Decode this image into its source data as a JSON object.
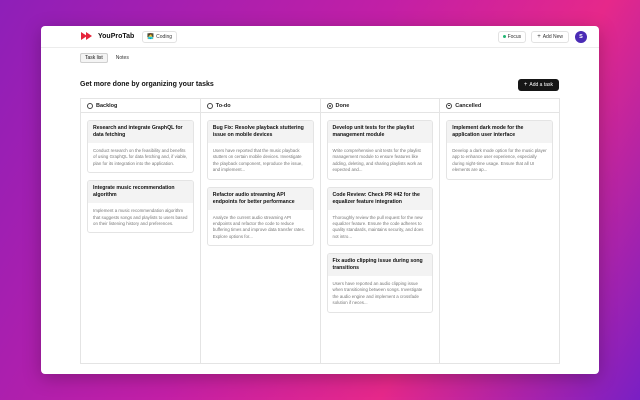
{
  "header": {
    "app_name": "YouProTab",
    "workspace": {
      "emoji": "🧑‍💻",
      "label": "Coding"
    },
    "focus_label": "Focus",
    "add_new_label": "Add New",
    "avatar_initial": "S",
    "colors": {
      "logo": "#e5243b",
      "avatar": "#4a2bb5",
      "focus_dot": "#22b573"
    }
  },
  "tabs": [
    {
      "label": "Task list",
      "active": true
    },
    {
      "label": "Notes",
      "active": false
    }
  ],
  "main": {
    "title": "Get more done by organizing your tasks",
    "add_task_label": "Add a task"
  },
  "columns": [
    {
      "name": "Backlog",
      "icon": "circle-icon",
      "cards": [
        {
          "title": "Research and integrate GraphQL for data fetching",
          "description": "Conduct research on the feasibility and benefits of using GraphQL for data fetching and, if viable, plan for its integration into the application."
        },
        {
          "title": "Integrate music recommendation algorithm",
          "description": "Implement a music recommendation algorithm that suggests songs and playlists to users based on their listening history and preferences."
        }
      ]
    },
    {
      "name": "To-do",
      "icon": "circle-icon",
      "cards": [
        {
          "title": "Bug Fix: Resolve playback stuttering issue on mobile devices",
          "description": "Users have reported that the music playback stutters on certain mobile devices. Investigate the playback component, reproduce the issue, and implement..."
        },
        {
          "title": "Refactor audio streaming API endpoints for better performance",
          "description": "Analyze the current audio streaming API endpoints and refactor the code to reduce buffering times and improve data transfer rates. Explore options for..."
        }
      ]
    },
    {
      "name": "Done",
      "icon": "circle-dot-icon",
      "cards": [
        {
          "title": "Develop unit tests for the playlist management module",
          "description": "Write comprehensive unit tests for the playlist management module to ensure features like adding, deleting, and sharing playlists work as expected and..."
        },
        {
          "title": "Code Review: Check PR #42 for the equalizer feature integration",
          "description": "Thoroughly review the pull request for the new equalizer feature. Ensure the code adheres to quality standards, maintains security, and does not intro..."
        },
        {
          "title": "Fix audio clipping issue during song transitions",
          "description": "Users have reported an audio clipping issue when transitioning between songs. Investigate the audio engine and implement a crossfade solution if neces..."
        }
      ]
    },
    {
      "name": "Cancelled",
      "icon": "circle-minus-icon",
      "cards": [
        {
          "title": "Implement dark mode for the application user interface",
          "description": "Develop a dark mode option for the music player app to enhance user experience, especially during night-time usage. Ensure that all UI elements are ap..."
        }
      ]
    }
  ]
}
